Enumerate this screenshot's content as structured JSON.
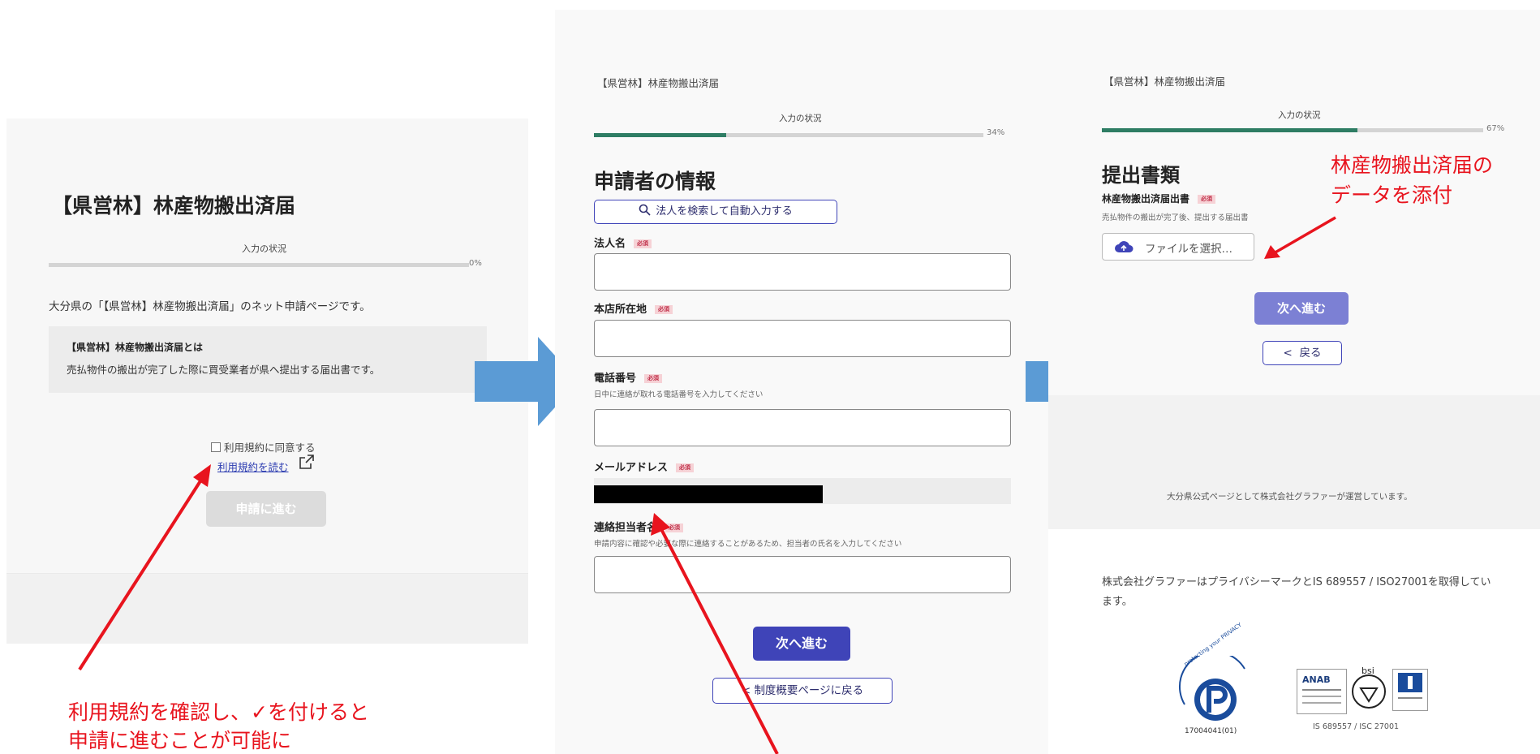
{
  "colors": {
    "accent": "#3f44b8",
    "progress": "#2e7d64",
    "annotation": "#e8141e",
    "flow_arrow": "#5b9bd5"
  },
  "step1": {
    "title": "【県営林】林産物搬出済届",
    "progress_label": "入力の状況",
    "progress_value": 0,
    "progress_text": "0%",
    "intro": "大分県の「【県営林】林産物搬出済届」のネット申請ページです。",
    "about_title": "【県営林】林産物搬出済届とは",
    "about_body": "売払物件の搬出が完了した際に買受業者が県へ提出する届出書です。",
    "agree_label": "利用規約に同意する",
    "terms_link": "利用規約を読む",
    "submit_label": "申請に進む"
  },
  "step2": {
    "form_name": "【県営林】林産物搬出済届",
    "progress_label": "入力の状況",
    "progress_value": 34,
    "progress_text": "34%",
    "section_title": "申請者の情報",
    "search_button": "法人を検索して自動入力する",
    "required_badge": "必須",
    "corp_name_label": "法人名",
    "address_label": "本店所在地",
    "phone_label": "電話番号",
    "phone_hint": "日中に連絡が取れる電話番号を入力してください",
    "email_label": "メールアドレス",
    "contact_label": "連絡担当者名",
    "contact_hint": "申請内容に確認や必要な際に連絡することがあるため、担当者の氏名を入力してください",
    "next_label": "次へ進む",
    "back_label": "制度概要ページに戻る"
  },
  "step3": {
    "form_name": "【県営林】林産物搬出済届",
    "progress_label": "入力の状況",
    "progress_value": 67,
    "progress_text": "67%",
    "section_title": "提出書類",
    "doc_label": "林産物搬出済届出書",
    "required_badge": "必須",
    "doc_hint": "売払物件の搬出が完了後、提出する届出書",
    "file_button": "ファイルを選択…",
    "next_label": "次へ進む",
    "back_label": "戻る",
    "footer_operated": "大分県公式ページとして株式会社グラファーが運営しています。",
    "privacy_statement": "株式会社グラファーはプライバシーマークとIS 689557 / ISO27001を取得しています。",
    "pmark_number": "17004041(01)",
    "pmark_text": "protecting your PRIVACY",
    "cert_caption": "IS 689557 / ISC 27001"
  },
  "annotations": {
    "agree_note_line1": "利用規約を確認し、✓を付けると",
    "agree_note_line2": "申請に進むことが可能に",
    "attach_note_line1": "林産物搬出済届の",
    "attach_note_line2": "データを添付"
  }
}
